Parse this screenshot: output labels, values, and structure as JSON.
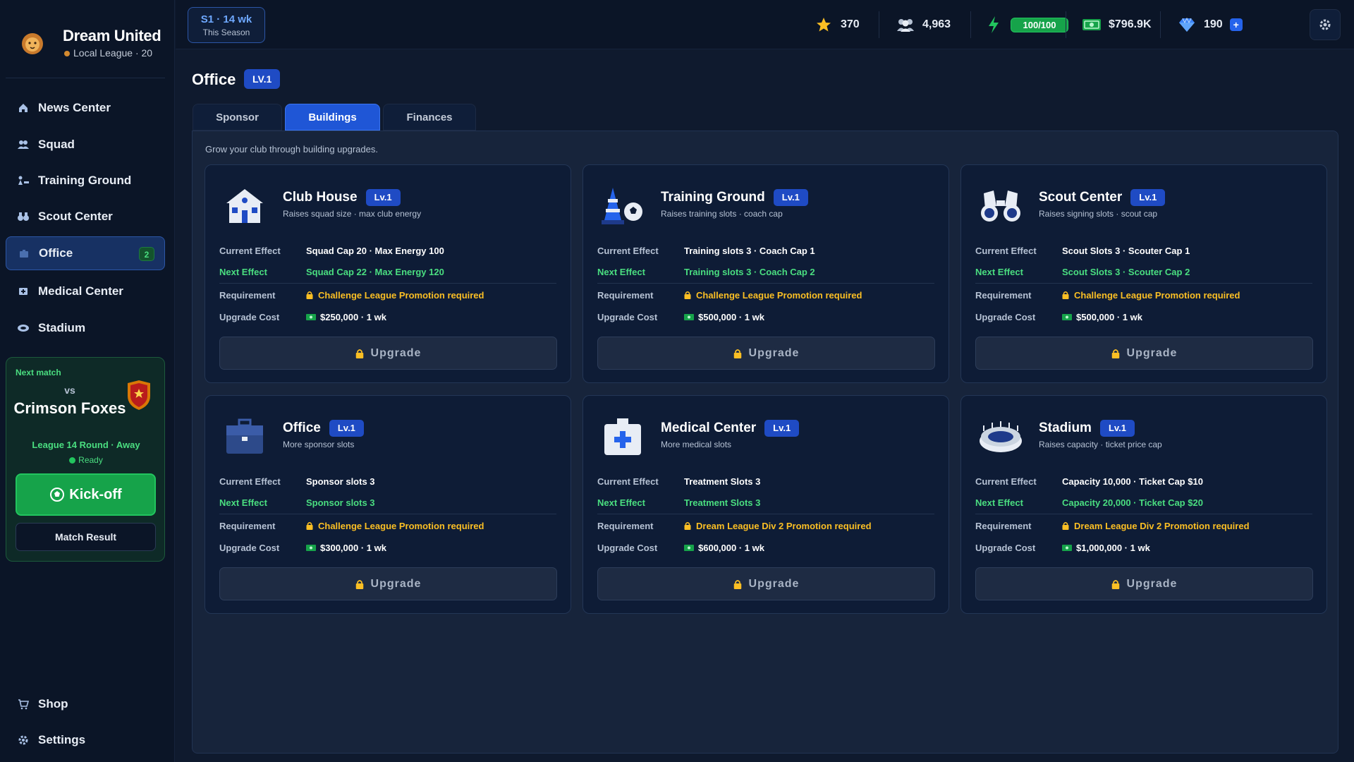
{
  "club": {
    "name": "Dream United",
    "league": "Local League · 20"
  },
  "nav": [
    {
      "label": "News Center",
      "icon": "home-icon"
    },
    {
      "label": "Squad",
      "icon": "team-icon"
    },
    {
      "label": "Training Ground",
      "icon": "training-icon"
    },
    {
      "label": "Scout Center",
      "icon": "binoculars-icon"
    },
    {
      "label": "Office",
      "icon": "briefcase-icon",
      "badge": "2"
    },
    {
      "label": "Medical Center",
      "icon": "medical-icon"
    },
    {
      "label": "Stadium",
      "icon": "stadium-icon"
    },
    {
      "label": "Shop",
      "icon": "cart-icon"
    },
    {
      "label": "Settings",
      "icon": "gear-icon"
    }
  ],
  "next_match": {
    "heading": "Next match",
    "vs": "vs",
    "opponent": "Crimson Foxes",
    "round": "League 14 Round · Away",
    "status": "Ready",
    "kickoff_label": "Kick-off",
    "result_label": "Match Result"
  },
  "topbar": {
    "season": "S1 · 14 wk",
    "season_sub": "This Season",
    "stars": "370",
    "fans": "4,963",
    "energy": "100/100",
    "cash": "$796.9K",
    "gems": "190",
    "gems_plus": "+"
  },
  "page": {
    "title": "Office",
    "level": "LV.1",
    "intro": "Grow your club through building upgrades."
  },
  "tabs": [
    {
      "label": "Sponsor"
    },
    {
      "label": "Buildings"
    },
    {
      "label": "Finances"
    }
  ],
  "labels": {
    "current": "Current Effect",
    "next": "Next Effect",
    "requirement": "Requirement",
    "cost": "Upgrade Cost",
    "upgrade": "Upgrade"
  },
  "buildings": [
    {
      "name": "Club House",
      "level": "Lv.1",
      "desc": "Raises squad size · max club energy",
      "current": "Squad Cap 20 · Max Energy 100",
      "next": "Squad Cap 22 · Max Energy 120",
      "requirement": "Challenge League Promotion required",
      "cost": "$250,000 · 1 wk",
      "icon": "clubhouse-icon"
    },
    {
      "name": "Training Ground",
      "level": "Lv.1",
      "desc": "Raises training slots · coach cap",
      "current": "Training slots 3 · Coach Cap 1",
      "next": "Training slots 3 · Coach Cap 2",
      "requirement": "Challenge League Promotion required",
      "cost": "$500,000 · 1 wk",
      "icon": "cone-ball-icon"
    },
    {
      "name": "Scout Center",
      "level": "Lv.1",
      "desc": "Raises signing slots · scout cap",
      "current": "Scout Slots 3 · Scouter Cap 1",
      "next": "Scout Slots 3 · Scouter Cap 2",
      "requirement": "Challenge League Promotion required",
      "cost": "$500,000 · 1 wk",
      "icon": "binoculars-icon"
    },
    {
      "name": "Office",
      "level": "Lv.1",
      "desc": "More sponsor slots",
      "current": "Sponsor slots 3",
      "next": "Sponsor slots 3",
      "requirement": "Challenge League Promotion required",
      "cost": "$300,000 · 1 wk",
      "icon": "briefcase-icon"
    },
    {
      "name": "Medical Center",
      "level": "Lv.1",
      "desc": "More medical slots",
      "current": "Treatment Slots 3",
      "next": "Treatment Slots 3",
      "requirement": "Dream League Div 2 Promotion required",
      "cost": "$600,000 · 1 wk",
      "icon": "medical-kit-icon"
    },
    {
      "name": "Stadium",
      "level": "Lv.1",
      "desc": "Raises capacity · ticket price cap",
      "current": "Capacity 10,000 · Ticket Cap $10",
      "next": "Capacity 20,000 · Ticket Cap $20",
      "requirement": "Dream League Div 2 Promotion required",
      "cost": "$1,000,000 · 1 wk",
      "icon": "stadium-icon"
    }
  ],
  "colors": {
    "accent": "#1f56d6",
    "green": "#4ade80",
    "warning": "#fbbf24",
    "bg": "#0f1a2e"
  }
}
